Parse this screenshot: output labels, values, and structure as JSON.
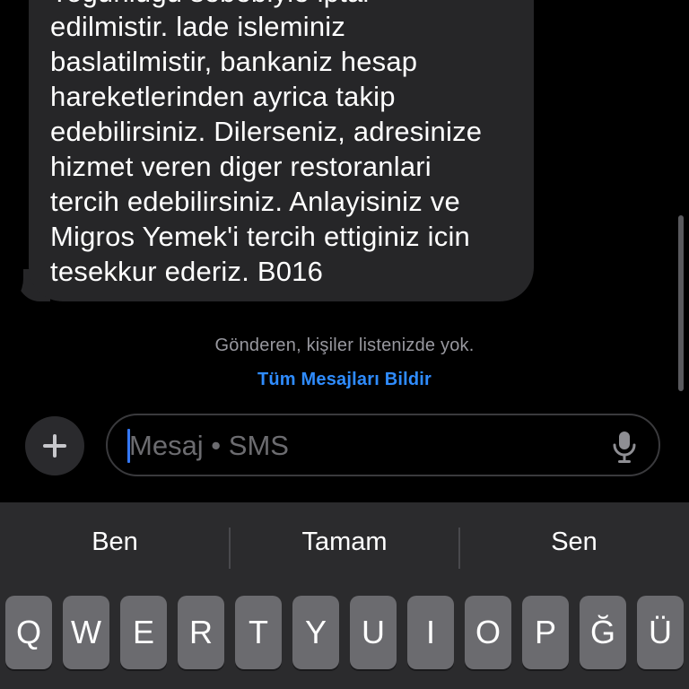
{
  "message": {
    "cut_line": "Yogunlugu sebebiyle iptal",
    "lines": [
      "edilmistir. lade isleminiz",
      "baslatilmistir, bankaniz hesap",
      "hareketlerinden ayrica takip",
      "edebilirsiniz. Dilerseniz, adresinize",
      "hizmet veren diger restoranlari",
      "tercih edebilirsiniz. Anlayisiniz ve",
      "Migros Yemek'i tercih ettiginiz icin",
      "tesekkur ederiz. B016"
    ]
  },
  "notice": {
    "sender_unknown": "Gönderen, kişiler listenizde yok.",
    "report_link": "Tüm Mesajları Bildir"
  },
  "compose": {
    "plus_icon": "plus-icon",
    "placeholder": "Mesaj • SMS",
    "value": "",
    "mic_icon": "microphone-icon"
  },
  "keyboard": {
    "suggestions": [
      "Ben",
      "Tamam",
      "Sen"
    ],
    "top_row": [
      "Q",
      "W",
      "E",
      "R",
      "T",
      "Y",
      "U",
      "I",
      "O",
      "P",
      "Ğ",
      "Ü"
    ]
  },
  "colors": {
    "background": "#000000",
    "bubble": "#262628",
    "link": "#2f8cff",
    "caret": "#3478f6",
    "keyboard": "#2b2b2d",
    "key": "#6b6b6f"
  }
}
